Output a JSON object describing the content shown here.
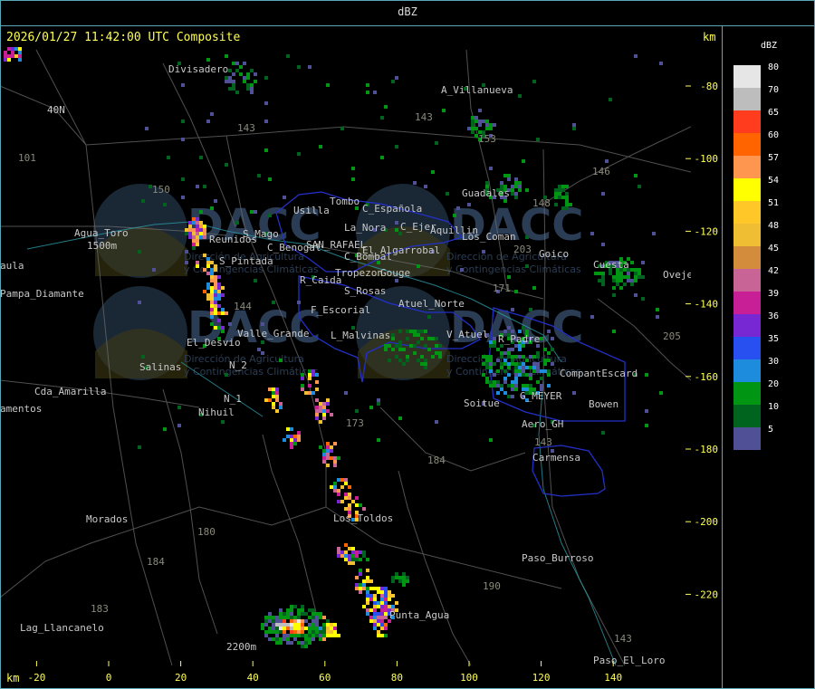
{
  "header": {
    "title": "dBZ"
  },
  "timestamp": "2026/01/27 11:42:00 UTC Composite",
  "axis": {
    "unit_top": "km",
    "unit_bottom": "km",
    "x_ticks": [
      "-20",
      "0",
      "20",
      "40",
      "60",
      "80",
      "100",
      "120",
      "140"
    ],
    "y_ticks": [
      "-80",
      "-100",
      "-120",
      "-140",
      "-160",
      "-180",
      "-200",
      "-220"
    ]
  },
  "places": [
    "Divisadero",
    "A_Villanueva",
    "Guadales",
    "Usilla",
    "Tombo",
    "C_Española",
    "La_Nora",
    "C_Ejer",
    "Aquillin",
    "Los_Coman",
    "Agua_Toro",
    "Reunidos",
    "S_Mago",
    "C_Benogal",
    "SAN_RAFAEL",
    "El_Algarrobal",
    "C_Bombal",
    "Goico",
    "Cuesta",
    "Oveje",
    "S_Pintada",
    "Pampa_Diamante",
    "R_Caida",
    "Tropezon",
    "Gouge",
    "S_Rosas",
    "Atuel_Norte",
    "F_Escorial",
    "Valle_Grande",
    "L_Malvinas",
    "V_Atuel",
    "R_Padre",
    "El_Desvio",
    "Salinas",
    "N_2",
    "Cda_Amarilla",
    "N_1",
    "Nihuil",
    "CompantEscard",
    "G_MEYER",
    "Soitue",
    "Bowen",
    "Aero_GH",
    "Carmensa",
    "Morados",
    "Los_Toldos",
    "Paso_Burroso",
    "Lag_Llancanelo",
    "Punta_Agua",
    "Paso_El_Loro",
    "aula",
    "amentos",
    "40N",
    "1500m",
    "2200m"
  ],
  "route_labels": [
    "143",
    "101",
    "150",
    "153",
    "148",
    "146",
    "203",
    "171",
    "144",
    "205",
    "173",
    "184",
    "180",
    "184",
    "190",
    "183",
    "143",
    "143",
    "143"
  ],
  "watermark": {
    "logo_text": "DACC",
    "org_line1": "Dirección de Agricultura",
    "org_line2": "y Contingencias Climáticas"
  },
  "legend": {
    "title": "dBZ",
    "entries": [
      {
        "label": "80",
        "color": "#e6e6e6"
      },
      {
        "label": "70",
        "color": "#bdbdbd"
      },
      {
        "label": "65",
        "color": "#ff3c1e"
      },
      {
        "label": "60",
        "color": "#ff6400"
      },
      {
        "label": "57",
        "color": "#ff9650"
      },
      {
        "label": "54",
        "color": "#ffff00"
      },
      {
        "label": "51",
        "color": "#ffc828"
      },
      {
        "label": "48",
        "color": "#f0be32"
      },
      {
        "label": "45",
        "color": "#d28c3c"
      },
      {
        "label": "42",
        "color": "#c86496"
      },
      {
        "label": "39",
        "color": "#c81e96"
      },
      {
        "label": "36",
        "color": "#7828d2"
      },
      {
        "label": "35",
        "color": "#2850f0"
      },
      {
        "label": "30",
        "color": "#1e8cdc"
      },
      {
        "label": "20",
        "color": "#009614"
      },
      {
        "label": "10",
        "color": "#00641e"
      },
      {
        "label": "5",
        "color": "#505096"
      }
    ]
  }
}
